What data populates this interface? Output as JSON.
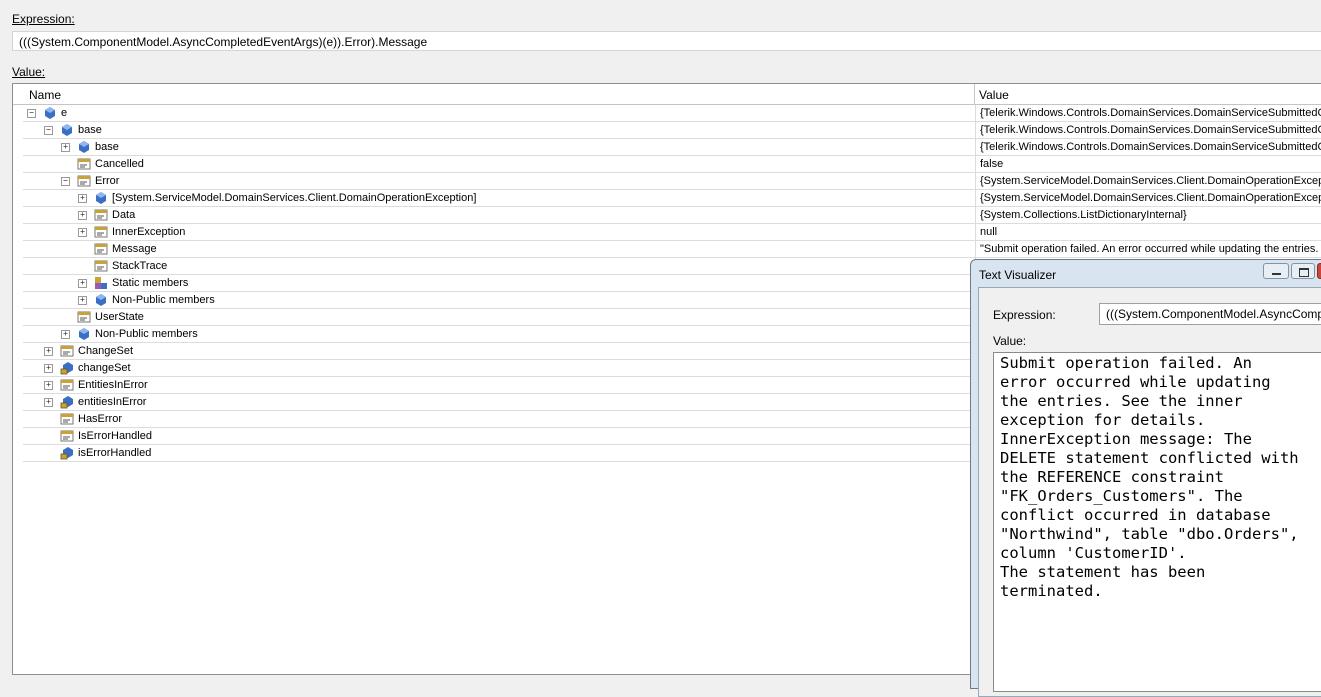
{
  "expression_label": "Expression:",
  "expression_value": "(((System.ComponentModel.AsyncCompletedEventArgs)(e)).Error).Message",
  "value_label": "Value:",
  "grid": {
    "headers": {
      "name": "Name",
      "value": "Value"
    },
    "rows": [
      {
        "depth": 0,
        "expander": "minus",
        "icon": "field-icon",
        "name": "e",
        "value": "{Telerik.Windows.Controls.DomainServices.DomainServiceSubmittedCha"
      },
      {
        "depth": 1,
        "expander": "minus",
        "icon": "field-icon",
        "name": "base",
        "value": "{Telerik.Windows.Controls.DomainServices.DomainServiceSubmittedCha"
      },
      {
        "depth": 2,
        "expander": "plus",
        "icon": "field-icon",
        "name": "base",
        "value": "{Telerik.Windows.Controls.DomainServices.DomainServiceSubmittedCha"
      },
      {
        "depth": 2,
        "expander": "none",
        "icon": "property-icon",
        "name": "Cancelled",
        "value": "false"
      },
      {
        "depth": 2,
        "expander": "minus",
        "icon": "property-icon",
        "name": "Error",
        "value": "{System.ServiceModel.DomainServices.Client.DomainOperationExceptio"
      },
      {
        "depth": 3,
        "expander": "plus",
        "icon": "field-icon",
        "name": "[System.ServiceModel.DomainServices.Client.DomainOperationException]",
        "value": "{System.ServiceModel.DomainServices.Client.DomainOperationExceptio"
      },
      {
        "depth": 3,
        "expander": "plus",
        "icon": "property-icon",
        "name": "Data",
        "value": "{System.Collections.ListDictionaryInternal}"
      },
      {
        "depth": 3,
        "expander": "plus",
        "icon": "property-icon",
        "name": "InnerException",
        "value": "null"
      },
      {
        "depth": 3,
        "expander": "none",
        "icon": "property-icon",
        "name": "Message",
        "value": "\"Submit operation failed. An error occurred while updating the entries. S"
      },
      {
        "depth": 3,
        "expander": "none",
        "icon": "property-icon",
        "name": "StackTrace",
        "value": ""
      },
      {
        "depth": 3,
        "expander": "plus",
        "icon": "static-members-icon",
        "name": "Static members",
        "value": ""
      },
      {
        "depth": 3,
        "expander": "plus",
        "icon": "field-icon",
        "name": "Non-Public members",
        "value": ""
      },
      {
        "depth": 2,
        "expander": "none",
        "icon": "property-icon",
        "name": "UserState",
        "value": ""
      },
      {
        "depth": 2,
        "expander": "plus",
        "icon": "field-icon",
        "name": "Non-Public members",
        "value": ""
      },
      {
        "depth": 1,
        "expander": "plus",
        "icon": "property-icon",
        "name": "ChangeSet",
        "value": ""
      },
      {
        "depth": 1,
        "expander": "plus",
        "icon": "private-field-icon",
        "name": "changeSet",
        "value": ""
      },
      {
        "depth": 1,
        "expander": "plus",
        "icon": "property-icon",
        "name": "EntitiesInError",
        "value": ""
      },
      {
        "depth": 1,
        "expander": "plus",
        "icon": "private-field-icon",
        "name": "entitiesInError",
        "value": ""
      },
      {
        "depth": 1,
        "expander": "none",
        "icon": "property-icon",
        "name": "HasError",
        "value": ""
      },
      {
        "depth": 1,
        "expander": "none",
        "icon": "property-icon",
        "name": "IsErrorHandled",
        "value": ""
      },
      {
        "depth": 1,
        "expander": "none",
        "icon": "private-field-icon",
        "name": "isErrorHandled",
        "value": ""
      }
    ]
  },
  "text_visualizer": {
    "title": "Text Visualizer",
    "expression_label": "Expression:",
    "expression_value": "(((System.ComponentModel.AsyncComp",
    "value_label": "Value:",
    "text": "Submit operation failed. An\nerror occurred while updating\nthe entries. See the inner\nexception for details.\nInnerException message: The\nDELETE statement conflicted with\nthe REFERENCE constraint\n\"FK_Orders_Customers\". The\nconflict occurred in database\n\"Northwind\", table \"dbo.Orders\",\ncolumn 'CustomerID'.\nThe statement has been\nterminated."
  },
  "colors": {
    "field_icon": "#3a6fc4",
    "property_icon": "#c9a23a"
  }
}
